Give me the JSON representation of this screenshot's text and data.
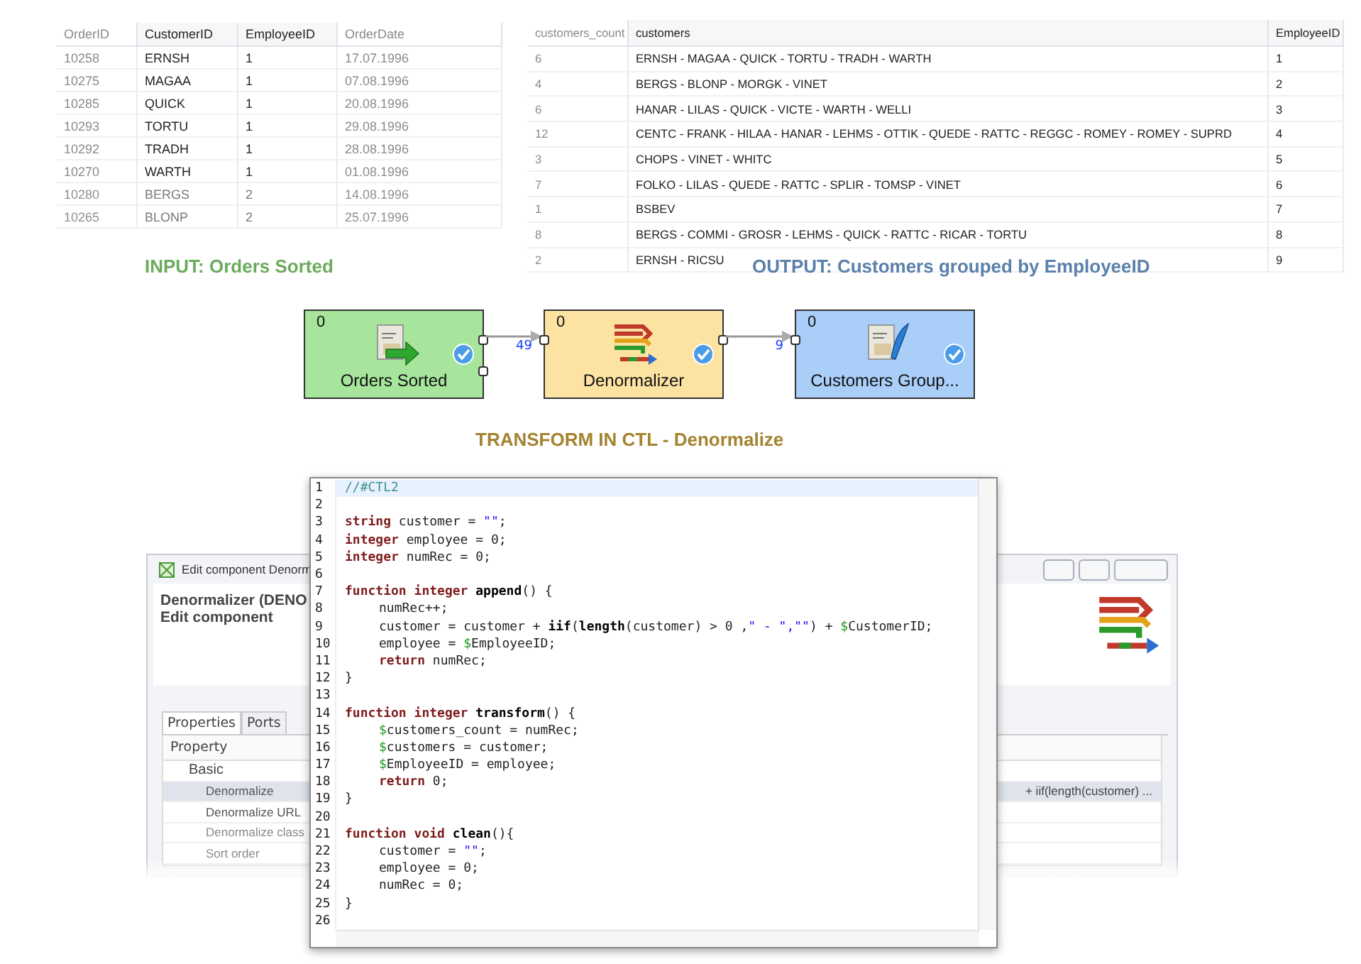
{
  "input_table": {
    "columns": [
      {
        "label": "OrderID",
        "faded": true
      },
      {
        "label": "CustomerID",
        "faded": false
      },
      {
        "label": "EmployeeID",
        "faded": false
      },
      {
        "label": "OrderDate",
        "faded": true
      }
    ],
    "rows": [
      {
        "cells": [
          "10258",
          "ERNSH",
          "1",
          "17.07.1996"
        ],
        "faded": false
      },
      {
        "cells": [
          "10275",
          "MAGAA",
          "1",
          "07.08.1996"
        ],
        "faded": false
      },
      {
        "cells": [
          "10285",
          "QUICK",
          "1",
          "20.08.1996"
        ],
        "faded": false
      },
      {
        "cells": [
          "10293",
          "TORTU",
          "1",
          "29.08.1996"
        ],
        "faded": false
      },
      {
        "cells": [
          "10292",
          "TRADH",
          "1",
          "28.08.1996"
        ],
        "faded": false
      },
      {
        "cells": [
          "10270",
          "WARTH",
          "1",
          "01.08.1996"
        ],
        "faded": false
      },
      {
        "cells": [
          "10280",
          "BERGS",
          "2",
          "14.08.1996"
        ],
        "faded": true
      },
      {
        "cells": [
          "10265",
          "BLONP",
          "2",
          "25.07.1996"
        ],
        "faded": true
      }
    ]
  },
  "output_table": {
    "columns": [
      {
        "label": "customers_count",
        "faded": true
      },
      {
        "label": "customers",
        "faded": false
      },
      {
        "label": "EmployeeID",
        "faded": false
      }
    ],
    "rows": [
      {
        "cells": [
          "6",
          "ERNSH - MAGAA - QUICK - TORTU - TRADH - WARTH",
          "1"
        ],
        "faded": false
      },
      {
        "cells": [
          "4",
          "BERGS - BLONP - MORGK - VINET",
          "2"
        ],
        "faded": false
      },
      {
        "cells": [
          "6",
          "HANAR - LILAS - QUICK - VICTE - WARTH - WELLI",
          "3"
        ],
        "faded": false
      },
      {
        "cells": [
          "12",
          "CENTC - FRANK - HILAA - HANAR - LEHMS - OTTIK - QUEDE - RATTC - REGGC - ROMEY - ROMEY - SUPRD",
          "4"
        ],
        "faded": false
      },
      {
        "cells": [
          "3",
          "CHOPS - VINET - WHITC",
          "5"
        ],
        "faded": false
      },
      {
        "cells": [
          "7",
          "FOLKO - LILAS - QUEDE - RATTC - SPLIR - TOMSP - VINET",
          "6"
        ],
        "faded": false
      },
      {
        "cells": [
          "1",
          "BSBEV",
          "7"
        ],
        "faded": false
      },
      {
        "cells": [
          "8",
          "BERGS - COMMI - GROSR - LEHMS - QUICK - RATTC - RICAR - TORTU",
          "8"
        ],
        "faded": false
      },
      {
        "cells": [
          "2",
          "ERNSH - RICSU",
          "9"
        ],
        "faded": false
      }
    ]
  },
  "captions": [
    {
      "text": "INPUT: Orders Sorted",
      "color": "#6aab5c"
    },
    {
      "text": "OUTPUT: Customers grouped by EmployeeID",
      "color": "#5b80ab"
    },
    {
      "text": "TRANSFORM IN CTL - Denormalize",
      "color": "#a3832f"
    }
  ],
  "graph": {
    "nodes": [
      {
        "kind": "reader",
        "label": "Orders Sorted",
        "count": "0",
        "color": "#a6e59b"
      },
      {
        "kind": "denormalizer",
        "label": "Denormalizer",
        "count": "0",
        "color": "#fce3a2"
      },
      {
        "kind": "writer",
        "label": "Customers Group...",
        "count": "0",
        "color": "#a9cef8"
      }
    ],
    "edges": [
      {
        "records": "49"
      },
      {
        "records": "9"
      }
    ]
  },
  "dialog": {
    "title": "Edit component Denorm",
    "heading": "Denormalizer (DENO",
    "subheading": "Edit component",
    "tabs": [
      {
        "label": "Properties",
        "selected": true
      },
      {
        "label": "Ports",
        "selected": false
      }
    ],
    "property_header": "Property",
    "properties": [
      {
        "kind": "group",
        "name": "Basic",
        "selected": false,
        "disabled": false
      },
      {
        "kind": "property",
        "name": "Denormalize",
        "value": "+ iif(length(customer) ...",
        "selected": true,
        "disabled": false
      },
      {
        "kind": "property",
        "name": "Denormalize URL",
        "selected": false,
        "disabled": false
      },
      {
        "kind": "property",
        "name": "Denormalize class",
        "selected": false,
        "disabled": true
      },
      {
        "kind": "property",
        "name": "Sort order",
        "selected": false,
        "disabled": true
      }
    ]
  },
  "editor": {
    "lines": [
      {
        "number": "1",
        "current": true,
        "indent": false,
        "tokens": [
          {
            "kind": "comment",
            "text": "//#CTL2"
          }
        ]
      },
      {
        "number": "2",
        "current": false
      },
      {
        "number": "3",
        "current": false,
        "indent": false,
        "tokens": [
          {
            "kind": "type",
            "text": "string"
          },
          {
            "kind": "plain",
            "text": " customer = "
          },
          {
            "kind": "string",
            "text": "\"\""
          },
          {
            "kind": "plain",
            "text": ";"
          }
        ]
      },
      {
        "number": "4",
        "current": false,
        "indent": false,
        "tokens": [
          {
            "kind": "type",
            "text": "integer"
          },
          {
            "kind": "plain",
            "text": " employee = 0;"
          }
        ]
      },
      {
        "number": "5",
        "current": false,
        "indent": false,
        "tokens": [
          {
            "kind": "type",
            "text": "integer"
          },
          {
            "kind": "plain",
            "text": " numRec = 0;"
          }
        ]
      },
      {
        "number": "6",
        "current": false
      },
      {
        "number": "7",
        "current": false,
        "indent": false,
        "tokens": [
          {
            "kind": "keyword",
            "text": "function"
          },
          {
            "kind": "type",
            "text": " integer"
          },
          {
            "kind": "name",
            "text": " append"
          },
          {
            "kind": "plain",
            "text": "() {"
          }
        ]
      },
      {
        "number": "8",
        "current": false,
        "indent": true,
        "tokens": [
          {
            "kind": "plain",
            "text": "numRec++;"
          }
        ]
      },
      {
        "number": "9",
        "current": false,
        "indent": true,
        "tokens": [
          {
            "kind": "plain",
            "text": "customer = customer + "
          },
          {
            "kind": "name",
            "text": "iif"
          },
          {
            "kind": "plain",
            "text": "("
          },
          {
            "kind": "name",
            "text": "length"
          },
          {
            "kind": "plain",
            "text": "(customer) > 0 ,"
          },
          {
            "kind": "string",
            "text": "\" - \",\"\""
          },
          {
            "kind": "plain",
            "text": ") + "
          },
          {
            "kind": "field",
            "text": "$"
          },
          {
            "kind": "plain",
            "text": "CustomerID;"
          }
        ]
      },
      {
        "number": "10",
        "current": false,
        "indent": true,
        "tokens": [
          {
            "kind": "plain",
            "text": "employee = "
          },
          {
            "kind": "field",
            "text": "$"
          },
          {
            "kind": "plain",
            "text": "EmployeeID;"
          }
        ]
      },
      {
        "number": "11",
        "current": false,
        "indent": true,
        "tokens": [
          {
            "kind": "keyword",
            "text": "return"
          },
          {
            "kind": "plain",
            "text": " numRec;"
          }
        ]
      },
      {
        "number": "12",
        "current": false,
        "indent": false,
        "tokens": [
          {
            "kind": "plain",
            "text": "}"
          }
        ]
      },
      {
        "number": "13",
        "current": false
      },
      {
        "number": "14",
        "current": false,
        "indent": false,
        "tokens": [
          {
            "kind": "keyword",
            "text": "function"
          },
          {
            "kind": "type",
            "text": " integer"
          },
          {
            "kind": "name",
            "text": " transform"
          },
          {
            "kind": "plain",
            "text": "() {"
          }
        ]
      },
      {
        "number": "15",
        "current": false,
        "indent": true,
        "tokens": [
          {
            "kind": "field",
            "text": "$"
          },
          {
            "kind": "plain",
            "text": "customers_count = numRec;"
          }
        ]
      },
      {
        "number": "16",
        "current": false,
        "indent": true,
        "tokens": [
          {
            "kind": "field",
            "text": "$"
          },
          {
            "kind": "plain",
            "text": "customers = customer;"
          }
        ]
      },
      {
        "number": "17",
        "current": false,
        "indent": true,
        "tokens": [
          {
            "kind": "field",
            "text": "$"
          },
          {
            "kind": "plain",
            "text": "EmployeeID = employee;"
          }
        ]
      },
      {
        "number": "18",
        "current": false,
        "indent": true,
        "tokens": [
          {
            "kind": "keyword",
            "text": "return"
          },
          {
            "kind": "plain",
            "text": " 0;"
          }
        ]
      },
      {
        "number": "19",
        "current": false,
        "indent": false,
        "tokens": [
          {
            "kind": "plain",
            "text": "}"
          }
        ]
      },
      {
        "number": "20",
        "current": false
      },
      {
        "number": "21",
        "current": false,
        "indent": false,
        "tokens": [
          {
            "kind": "keyword",
            "text": "function"
          },
          {
            "kind": "type",
            "text": " void"
          },
          {
            "kind": "name",
            "text": " clean"
          },
          {
            "kind": "plain",
            "text": "(){"
          }
        ]
      },
      {
        "number": "22",
        "current": false,
        "indent": true,
        "tokens": [
          {
            "kind": "plain",
            "text": "customer = "
          },
          {
            "kind": "string",
            "text": "\"\""
          },
          {
            "kind": "plain",
            "text": ";"
          }
        ]
      },
      {
        "number": "23",
        "current": false,
        "indent": true,
        "tokens": [
          {
            "kind": "plain",
            "text": "employee = 0;"
          }
        ]
      },
      {
        "number": "24",
        "current": false,
        "indent": true,
        "tokens": [
          {
            "kind": "plain",
            "text": "numRec = 0;"
          }
        ]
      },
      {
        "number": "25",
        "current": false,
        "indent": false,
        "tokens": [
          {
            "kind": "plain",
            "text": "}"
          }
        ]
      },
      {
        "number": "26",
        "current": false
      }
    ]
  }
}
